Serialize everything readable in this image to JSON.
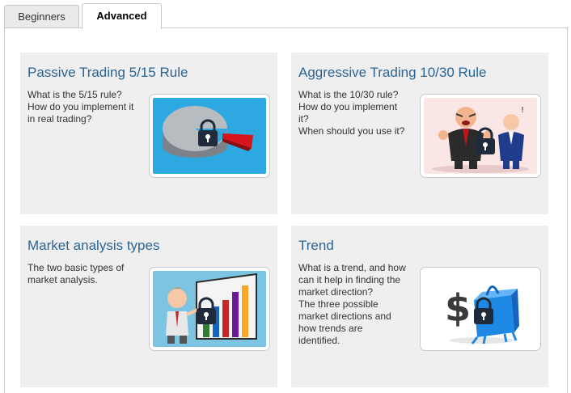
{
  "tabs": [
    {
      "label": "Beginners"
    },
    {
      "label": "Advanced"
    }
  ],
  "cards": [
    {
      "title": "Passive Trading 5/15 Rule",
      "lines": [
        "What is the 5/15 rule?",
        "How do you implement it",
        "in real trading?"
      ],
      "image": "pie-chart-lock-icon",
      "bg": "#2ea8e0"
    },
    {
      "title": "Aggressive Trading 10/30 Rule",
      "lines": [
        "What is the 10/30 rule?",
        "How do you implement",
        "it?",
        "When should you use it?"
      ],
      "image": "businessmen-argument-lock-icon",
      "bg": "#fbe6e6"
    },
    {
      "title": "Market analysis types",
      "lines": [
        "The two basic types of",
        "market analysis."
      ],
      "image": "bar-chart-presenter-lock-icon",
      "bg": "#7bc4e2"
    },
    {
      "title": "Trend",
      "lines": [
        "What is a trend, and how",
        "can it help in finding the",
        "market direction?",
        "The three possible",
        "market directions and",
        "how trends are",
        "identified."
      ],
      "image": "dollar-bag-lock-icon",
      "bg": "#ffffff"
    }
  ],
  "colors": {
    "title": "#2a6496",
    "card_bg": "#efefef",
    "lock": "#1f2a3a"
  }
}
